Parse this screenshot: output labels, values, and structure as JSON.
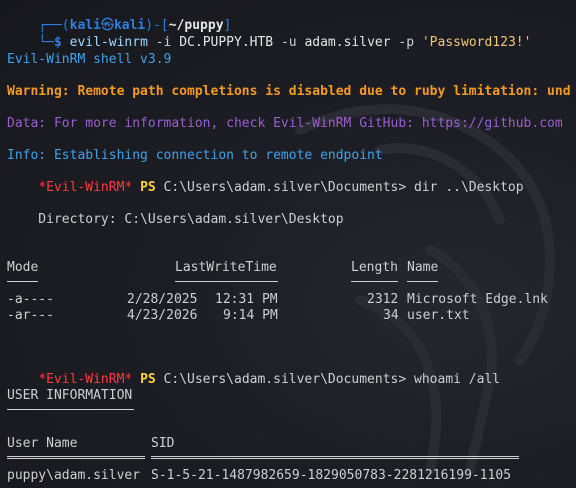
{
  "prompt": {
    "corner_top": "┌──(",
    "user": "kali",
    "at_symbol": "㉿",
    "host": "kali",
    "mid": ")-[",
    "dir": "~/puppy",
    "end": "]",
    "corner_bottom": "└─",
    "dollar": "$",
    "command": "evil-winrm",
    "args_1": " -i ",
    "target": "DC.PUPPY.HTB",
    "args_2": " -u ",
    "username": "adam.silver",
    "args_3": " -p ",
    "password": "'Password123!'"
  },
  "banner": {
    "version": "Evil-WinRM shell v3.9",
    "warning": "Warning: Remote path completions is disabled due to ruby limitation: und",
    "data": "Data: For more information, check Evil-WinRM GitHub: https://github.com",
    "info": "Info: Establishing connection to remote endpoint"
  },
  "session": {
    "shell_name": "*Evil-WinRM*",
    "ps_label": "PS",
    "cwd": "C:\\Users\\adam.silver\\Documents>",
    "cmd_1": "dir ..\\Desktop",
    "cmd_2": "whoami /all"
  },
  "dir_listing": {
    "directory_line": "    Directory: C:\\Users\\adam.silver\\Desktop",
    "headers": {
      "mode": "Mode",
      "last_write_time": "LastWriteTime",
      "length": "Length",
      "name": "Name"
    },
    "rows": [
      {
        "mode": "-a----",
        "date": "2/28/2025",
        "time": "12:31 PM",
        "length": "2312",
        "name": "Microsoft Edge.lnk"
      },
      {
        "mode": "-ar---",
        "date": "4/23/2026",
        "time": "9:14 PM",
        "length": "34",
        "name": "user.txt"
      }
    ]
  },
  "user_info": {
    "title": "USER INFORMATION",
    "col_user": "User Name",
    "col_sid": "SID",
    "user": "puppy\\adam.silver",
    "sid": "S-1-5-21-1487982659-1829050783-2281216199-1105"
  },
  "colors": {
    "background": "#1b1c22",
    "prompt_blue": "#2f7fe0",
    "warning_orange": "#f39a22",
    "data_purple": "#9a5ecf",
    "shell_red": "#ff3b3b",
    "ps_yellow": "#ffd23c"
  }
}
